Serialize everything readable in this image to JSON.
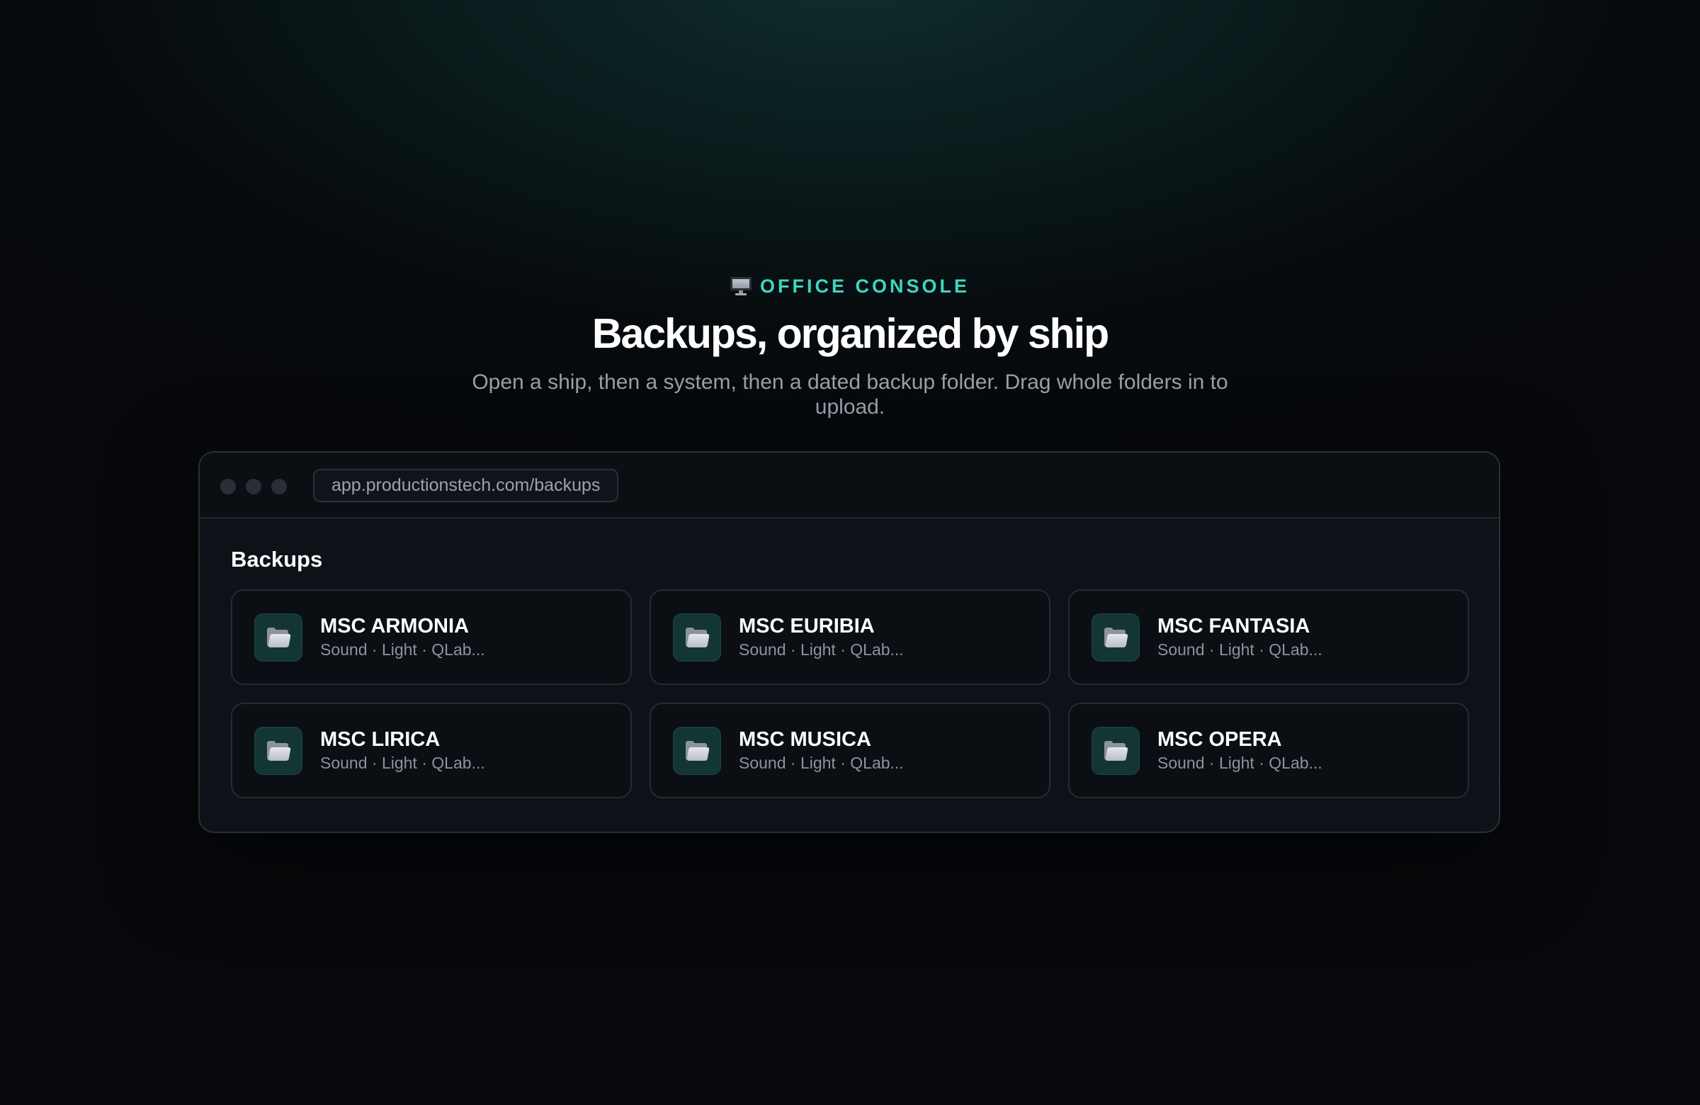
{
  "hero": {
    "eyebrow_icon": "desktop-computer-icon",
    "eyebrow": "OFFICE CONSOLE",
    "title": "Backups, organized by ship",
    "subtitle": "Open a ship, then a system, then a dated backup folder. Drag whole folders in to upload."
  },
  "window": {
    "url": "app.productionstech.com/backups"
  },
  "backups": {
    "title": "Backups",
    "ships": [
      {
        "name": "MSC ARMONIA",
        "systems": "Sound · Light · QLab...",
        "icon": "folder-icon"
      },
      {
        "name": "MSC EURIBIA",
        "systems": "Sound · Light · QLab...",
        "icon": "folder-icon"
      },
      {
        "name": "MSC FANTASIA",
        "systems": "Sound · Light · QLab...",
        "icon": "folder-icon"
      },
      {
        "name": "MSC LIRICA",
        "systems": "Sound · Light · QLab...",
        "icon": "folder-icon"
      },
      {
        "name": "MSC MUSICA",
        "systems": "Sound · Light · QLab...",
        "icon": "folder-icon"
      },
      {
        "name": "MSC OPERA",
        "systems": "Sound · Light · QLab...",
        "icon": "folder-icon"
      }
    ]
  },
  "colors": {
    "accent": "#3fd6bf",
    "background": "#06080b",
    "window": "#0d1117",
    "icon_tile": "#133634"
  }
}
